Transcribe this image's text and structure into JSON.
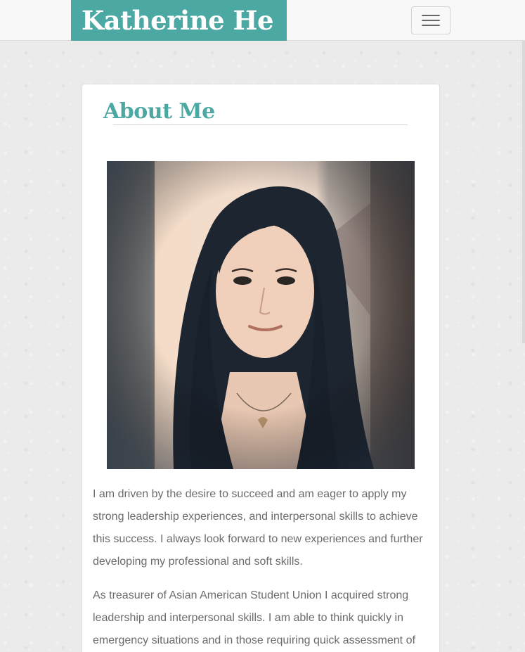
{
  "header": {
    "brand": "Katherine He",
    "menu_icon": "hamburger-menu-icon"
  },
  "about": {
    "title": "About Me",
    "photo_alt": "Katherine He",
    "paragraphs": [
      "I am driven by the desire to succeed and am eager to apply my strong leadership experiences, and interpersonal skills to achieve this success. I always look forward to new experiences and further developing my professional and soft skills.",
      "As treasurer of Asian American Student Union I acquired strong leadership and interpersonal skills. I am able to think quickly in emergency situations and in those requiring quick assessment of"
    ]
  },
  "colors": {
    "accent": "#4ca8a2",
    "text": "#6b6b6b",
    "navbar_bg": "#f8f8f8"
  }
}
